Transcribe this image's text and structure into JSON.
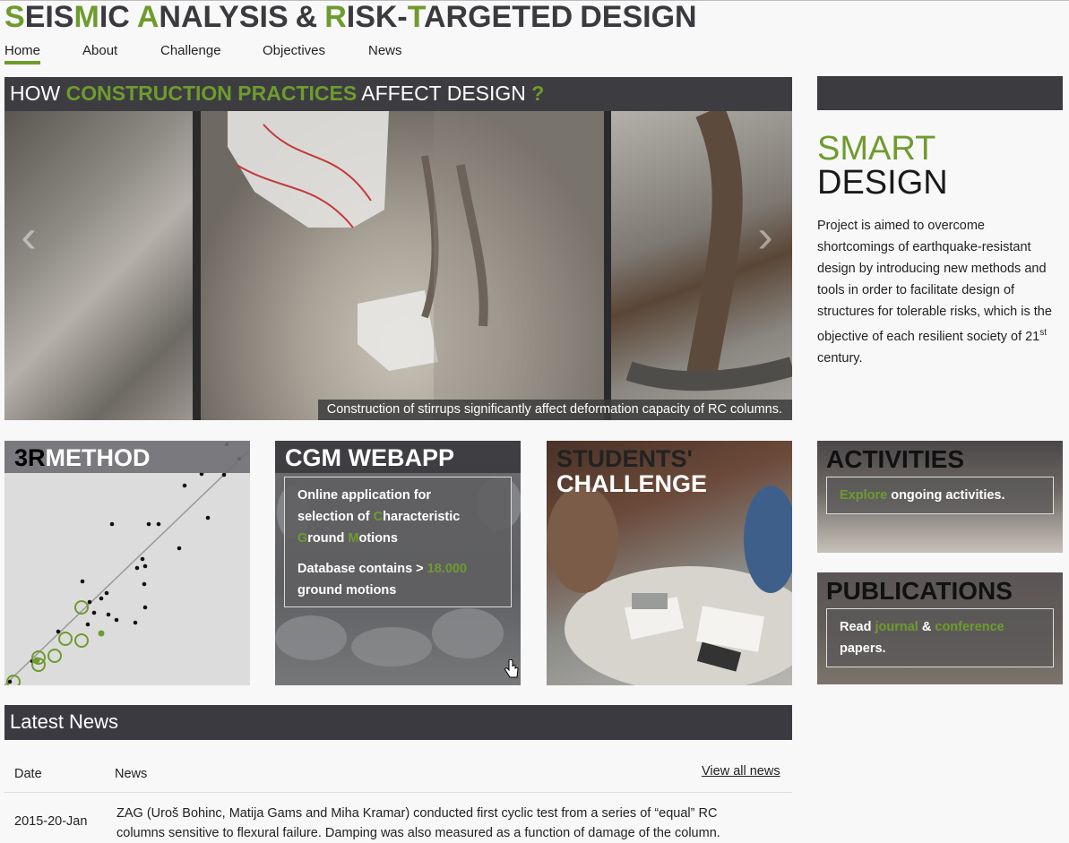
{
  "header": {
    "title_words": [
      {
        "first": "S",
        "mid": "EIS",
        "hl": "M",
        "rest": "IC"
      },
      {
        "first": "A",
        "rest": "NALYSIS"
      },
      {
        "first": "&",
        "rest": ""
      },
      {
        "first": "R",
        "rest": "ISK-"
      },
      {
        "first": "T",
        "rest": "ARGETED"
      },
      {
        "first": "D",
        "rest": "ESIGN"
      }
    ]
  },
  "nav": {
    "items": [
      "Home",
      "About",
      "Challenge",
      "Objectives",
      "News"
    ],
    "active": "Home"
  },
  "hero": {
    "title_pre": "HOW ",
    "title_hl": "CONSTRUCTION PRACTICES",
    "title_post": " AFFECT DESIGN ",
    "title_q": "?",
    "caption": "Construction of stirrups significantly affect deformation capacity of RC columns.",
    "prev_icon": "chevron-left-icon",
    "next_icon": "chevron-right-icon"
  },
  "smart": {
    "line1": "SMART",
    "line2": "DESIGN",
    "text_before": "Project is aimed to overcome shortcomings of earthquake-resistant design by introducing new methods and tools in order to facilitate design of structures for tolerable risks, which is the objective of each resilient society of 21",
    "sup": "st",
    "text_after": " century."
  },
  "tiles": {
    "method": {
      "title_k": "3R",
      "title_w": "METHOD"
    },
    "webapp": {
      "title": "CGM WEBAPP",
      "line1": "Online application for",
      "line2_pre": "selection of ",
      "c": "C",
      "line2_rest": "haracteristic",
      "g": "G",
      "line3_mid": "round ",
      "m": "M",
      "line3_rest": "otions",
      "db_pre": "Database contains > ",
      "db_num": "18.000",
      "db_post": "ground motions"
    },
    "challenge": {
      "line1": "STUDENTS'",
      "line2": "CHALLENGE"
    },
    "activities": {
      "title": "ACTIVITIES",
      "hl": "Explore",
      "rest": " ongoing activities."
    },
    "publications": {
      "title": "PUBLICATIONS",
      "pre": "Read ",
      "journal": "journal",
      "amp": " & ",
      "conference": "conference",
      "post": "papers."
    }
  },
  "news": {
    "heading": "Latest News",
    "col_date": "Date",
    "col_news": "News",
    "view_all": "View all news",
    "rows": [
      {
        "date": "2015-20-Jan",
        "text": "ZAG (Uroš Bohinc, Matija Gams and Miha Kramar) conducted first cyclic test from a series of “equal” RC columns sensitive to flexural failure. Damping was also measured as a function of damage of the column."
      }
    ]
  },
  "colors": {
    "accent": "#6e9b2e",
    "dark_bar": "#3b3a40"
  }
}
